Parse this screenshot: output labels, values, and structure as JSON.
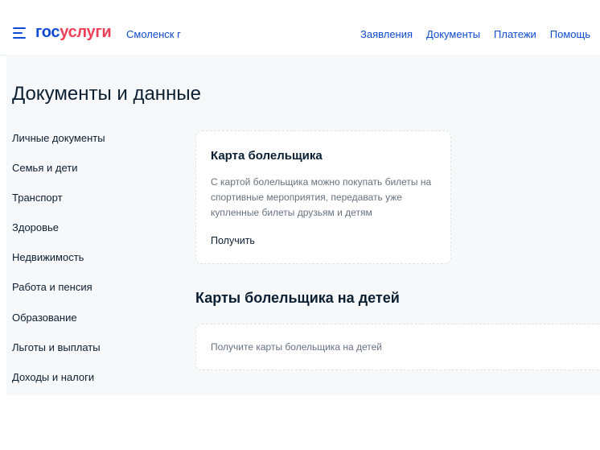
{
  "header": {
    "logo_part1": "гос",
    "logo_part2": "услуги",
    "city": "Смоленск г",
    "nav": [
      "Заявления",
      "Документы",
      "Платежи",
      "Помощь"
    ]
  },
  "page": {
    "title": "Документы и данные"
  },
  "sidebar": {
    "items": [
      "Личные документы",
      "Семья и дети",
      "Транспорт",
      "Здоровье",
      "Недвижимость",
      "Работа и пенсия",
      "Образование",
      "Льготы и выплаты",
      "Доходы и налоги"
    ]
  },
  "fan_card": {
    "title": "Карта болельщика",
    "description": "С картой болельщика можно покупать билеты на спортивные мероприятия, передавать уже купленные билеты друзьям и детям",
    "action": "Получить"
  },
  "children_section": {
    "title": "Карты болельщика на детей",
    "card_text": "Получите карты болельщика на детей"
  },
  "colors": {
    "brand_blue": "#0d4cd3",
    "brand_red": "#ee3f58",
    "text_dark": "#0b1f33",
    "text_muted": "#66727f"
  },
  "icons": [
    "menu-icon"
  ]
}
